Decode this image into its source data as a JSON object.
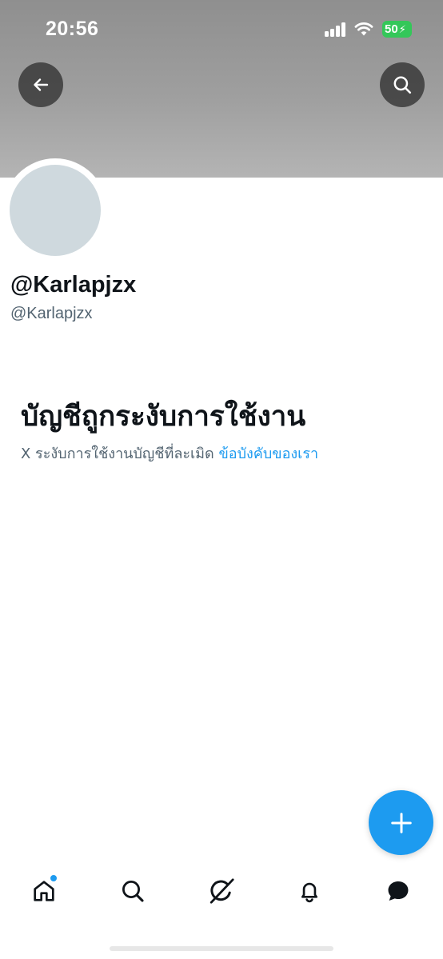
{
  "status_bar": {
    "time": "20:56",
    "battery_level": "50",
    "battery_color": "#34c759"
  },
  "header": {
    "back_icon": "arrow-left-icon",
    "search_icon": "search-icon"
  },
  "profile": {
    "display_name": "@Karlapjzx",
    "handle": "@Karlapjzx"
  },
  "suspension": {
    "title": "บัญชีถูกระงับการใช้งาน",
    "description": "X ระงับการใช้งานบัญชีที่ละเมิด",
    "link_text": "ข้อบังคับของเรา"
  },
  "fab": {
    "icon": "plus-icon"
  },
  "tab_bar": {
    "items": [
      {
        "icon": "home-icon",
        "has_notification_dot": true
      },
      {
        "icon": "search-icon"
      },
      {
        "icon": "grok-icon"
      },
      {
        "icon": "bell-icon"
      },
      {
        "icon": "messages-icon"
      }
    ]
  },
  "colors": {
    "accent": "#1d9bf0",
    "text_primary": "#0f1419",
    "text_secondary": "#536471",
    "avatar_placeholder": "#cfd9de"
  }
}
